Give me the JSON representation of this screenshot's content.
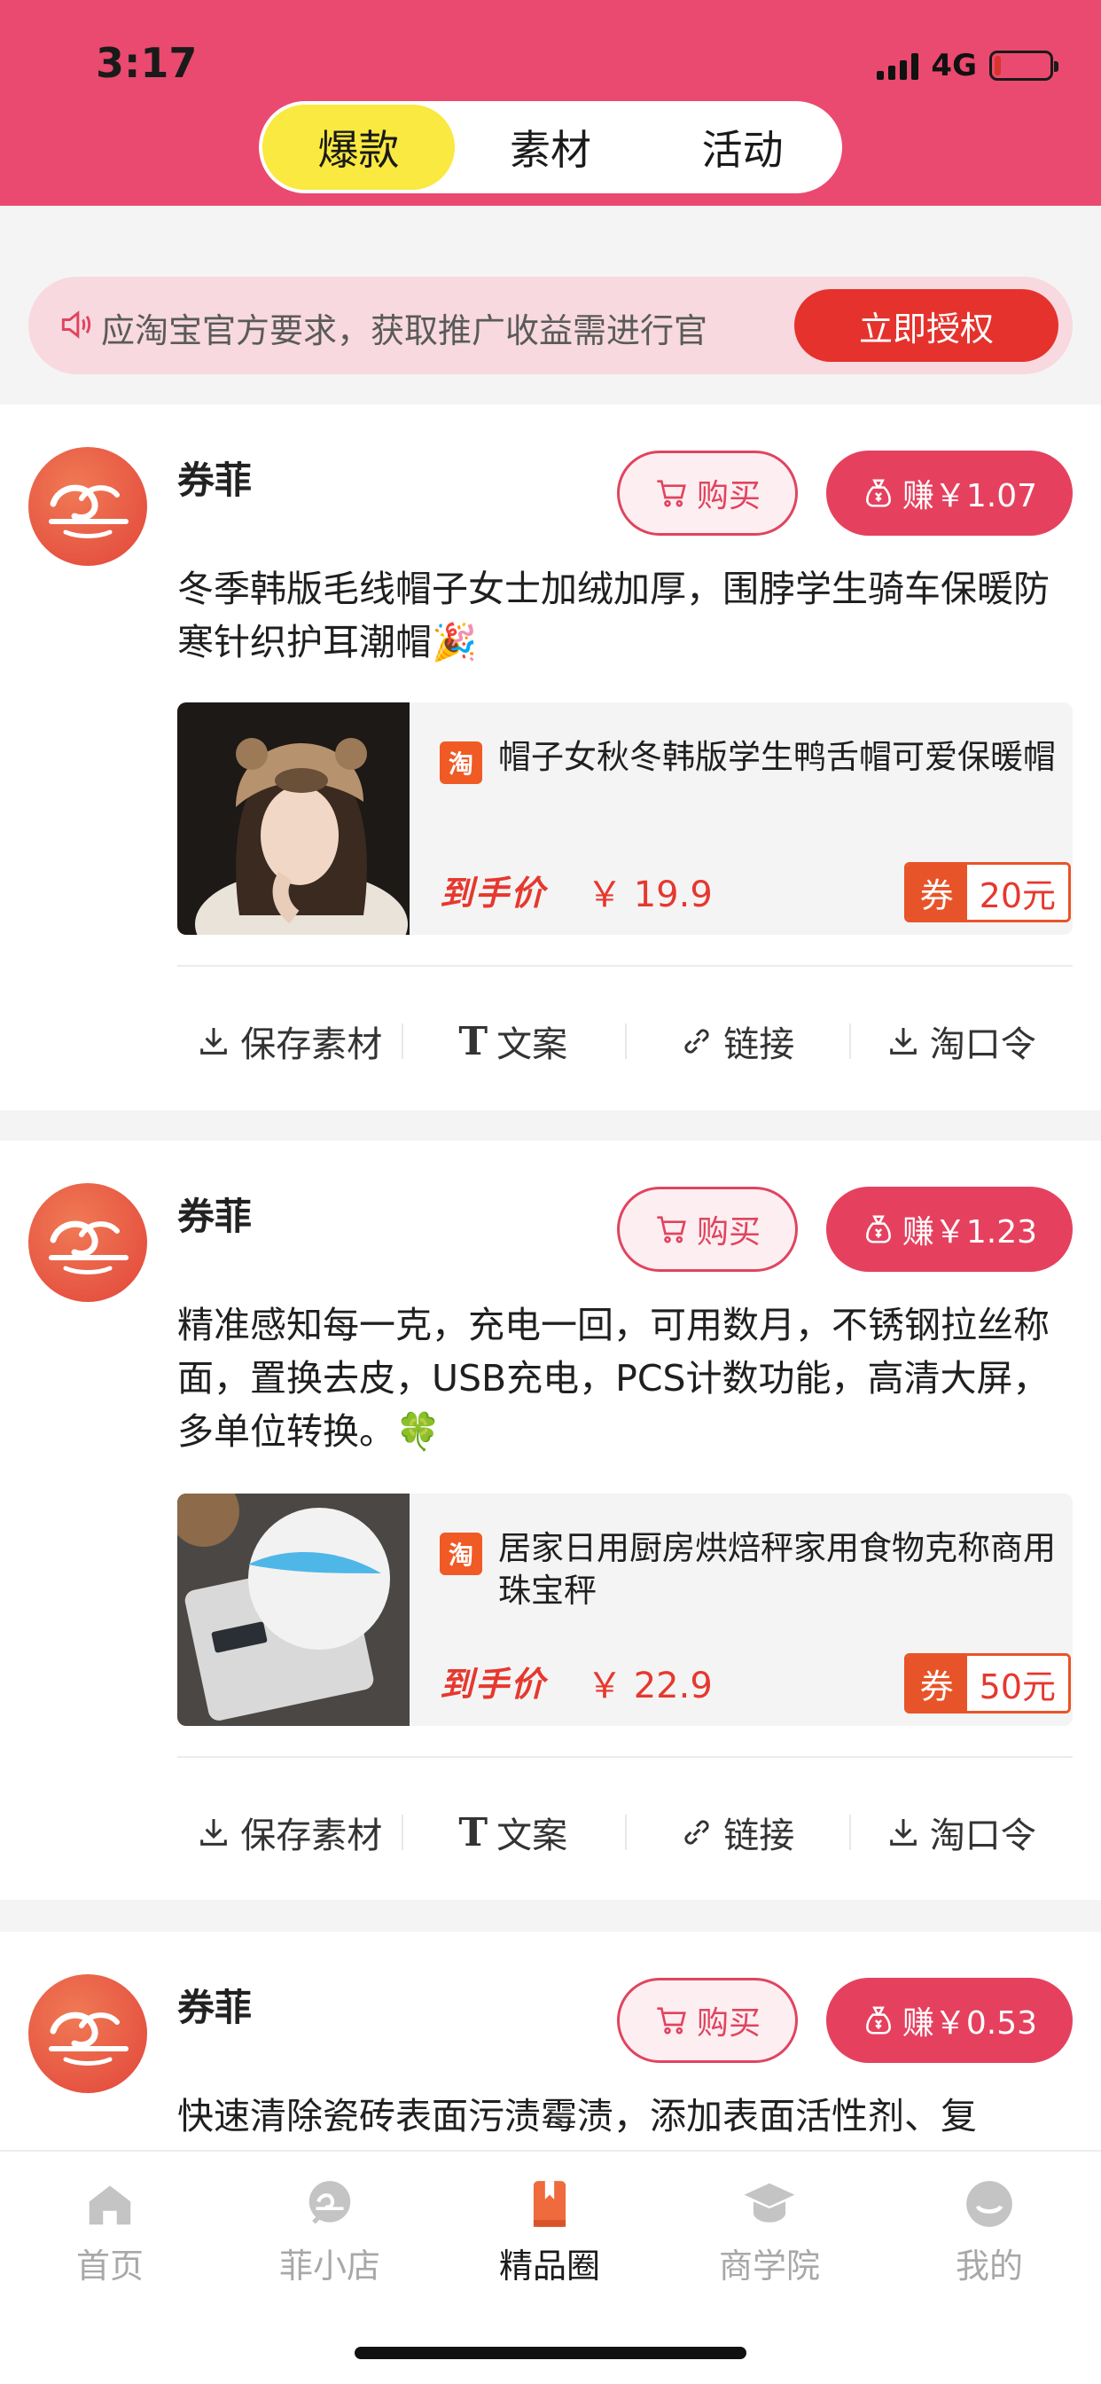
{
  "status": {
    "time": "3:17",
    "network": "4G"
  },
  "top_tabs": [
    {
      "label": "爆款",
      "active": true
    },
    {
      "label": "素材",
      "active": false
    },
    {
      "label": "活动",
      "active": false
    }
  ],
  "notice": {
    "text": "应淘宝官方要求，获取推广收益需进行官",
    "button": "立即授权"
  },
  "cards": [
    {
      "author": "券菲",
      "buy_label": "购买",
      "earn_label": "赚￥1.07",
      "description": "冬季韩版毛线帽子女士加绒加厚，围脖学生骑车保暖防寒针织护耳潮帽🎉",
      "product": {
        "platform": "淘",
        "title": "帽子女秋冬韩版学生鸭舌帽可爱保暖帽",
        "price_label": "到手价",
        "price": "￥ 19.9",
        "coupon_icon": "券",
        "coupon_value": "20元"
      },
      "actions": [
        "保存素材",
        "文案",
        "链接",
        "淘口令"
      ]
    },
    {
      "author": "券菲",
      "buy_label": "购买",
      "earn_label": "赚￥1.23",
      "description": "精准感知每一克，充电一回，可用数月，不锈钢拉丝称面，置换去皮，USB充电，PCS计数功能，高清大屏，多单位转换。🍀",
      "product": {
        "platform": "淘",
        "title": "居家日用厨房烘焙秤家用食物克称商用珠宝秤",
        "price_label": "到手价",
        "price": "￥ 22.9",
        "coupon_icon": "券",
        "coupon_value": "50元"
      },
      "actions": [
        "保存素材",
        "文案",
        "链接",
        "淘口令"
      ]
    },
    {
      "author": "券菲",
      "buy_label": "购买",
      "earn_label": "赚￥0.53",
      "description": "快速清除瓷砖表面污渍霉渍，添加表面活性剂、复"
    }
  ],
  "tabbar": [
    {
      "label": "首页",
      "icon": "home-icon",
      "active": false
    },
    {
      "label": "菲小店",
      "icon": "shop-icon",
      "active": false
    },
    {
      "label": "精品圈",
      "icon": "book-icon",
      "active": true
    },
    {
      "label": "商学院",
      "icon": "graduation-cap-icon",
      "active": false
    },
    {
      "label": "我的",
      "icon": "user-icon",
      "active": false
    }
  ],
  "colors": {
    "header": "#ea4a6f",
    "accent": "#e5415f",
    "active_tab": "#f9e940",
    "price": "#e6382f"
  }
}
